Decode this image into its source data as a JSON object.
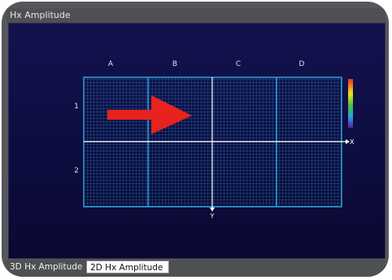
{
  "window": {
    "title": "Hx Amplitude"
  },
  "plot": {
    "column_labels": [
      "A",
      "B",
      "C",
      "D"
    ],
    "row_labels": [
      "1",
      "2"
    ],
    "x_axis_label": "X",
    "y_axis_label": "Y",
    "colors": {
      "background_top": "#14124e",
      "grid_line": "#2aa0d8",
      "grid_fine": "#1f6fa8",
      "axis_line": "#ffffff",
      "arrow": "#e8221e"
    },
    "color_scale": [
      "#e8302a",
      "#f0e020",
      "#40c040",
      "#30a0e0",
      "#5020a0"
    ]
  },
  "tabs": [
    {
      "label": "3D Hx Amplitude",
      "active": false
    },
    {
      "label": "2D Hx Amplitude",
      "active": true
    }
  ]
}
